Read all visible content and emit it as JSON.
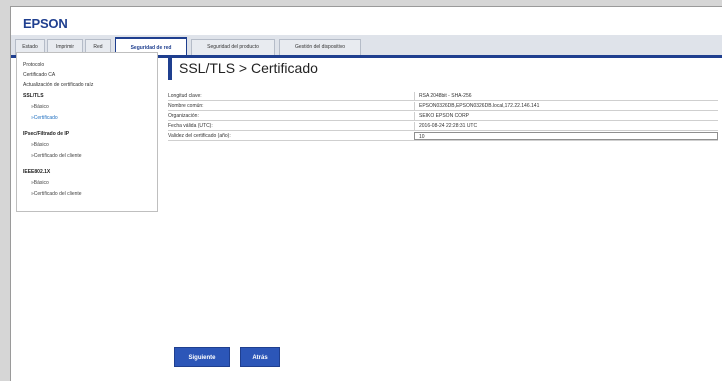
{
  "brand": {
    "logo": "EPSON"
  },
  "tabs": [
    {
      "label": "Estado"
    },
    {
      "label": "Imprimir"
    },
    {
      "label": "Red"
    },
    {
      "label": "Seguridad de red"
    },
    {
      "label": "Seguridad del producto"
    },
    {
      "label": "Gestión del dispositivo"
    }
  ],
  "sidebar": {
    "items": [
      {
        "label": "Protocolo"
      },
      {
        "label": "Certificado CA"
      },
      {
        "label": "Actualización de certificado raíz"
      },
      {
        "label": "SSL/TLS"
      },
      {
        "label": "»Básico"
      },
      {
        "label": "»Certificado"
      },
      {
        "label": "IPsec/Filtrado de IP"
      },
      {
        "label": "»Básico"
      },
      {
        "label": "»Certificado del cliente"
      },
      {
        "label": "IEEE802.1X"
      },
      {
        "label": "»Básico"
      },
      {
        "label": "»Certificado del cliente"
      }
    ]
  },
  "page": {
    "title": "SSL/TLS > Certificado"
  },
  "fields": [
    {
      "label": "Longitud clave:",
      "value": "RSA 2048bit - SHA-256"
    },
    {
      "label": "Nombre común:",
      "value": "EPSON0326DB,EPSON0326DB.local,172.22.146.141"
    },
    {
      "label": "Organización:",
      "value": "SEIKO EPSON CORP"
    },
    {
      "label": "Fecha válida (UTC):",
      "value": "2016-08-24 22:28:31 UTC"
    },
    {
      "label": "Validez del certificado (año):",
      "value": "10"
    }
  ],
  "buttons": {
    "next": "Siguiente",
    "back": "Atrás"
  },
  "colors": {
    "accent": "#1f3f8f",
    "button": "#2c56b8"
  }
}
